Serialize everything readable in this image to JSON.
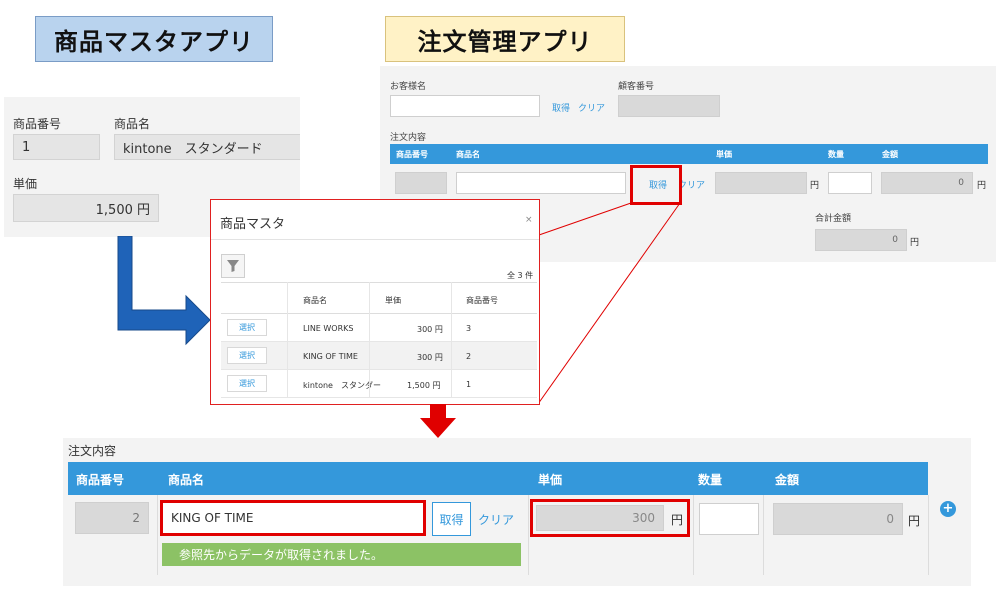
{
  "titles": {
    "product_master": "商品マスタアプリ",
    "order_app": "注文管理アプリ"
  },
  "product_master": {
    "code_label": "商品番号",
    "code_value": "1",
    "name_label": "商品名",
    "name_value": "kintone　スタンダード",
    "price_label": "単価",
    "price_value": "1,500 円"
  },
  "order_app": {
    "customer_label": "お客様名",
    "customer_value": "",
    "fetch": "取得",
    "clear": "クリア",
    "customer_no_label": "顧客番号",
    "order_content_label": "注文内容",
    "columns": [
      "商品番号",
      "商品名",
      "単価",
      "数量",
      "金額"
    ],
    "row": {
      "unit": "円",
      "amount": "0",
      "amount_unit": "円"
    },
    "total_label": "合計金額",
    "total_value": "0",
    "total_unit": "円"
  },
  "modal": {
    "title": "商品マスタ",
    "close": "×",
    "count": "全 3 件",
    "columns": [
      "商品名",
      "単価",
      "商品番号"
    ],
    "select_label": "選択",
    "rows": [
      {
        "name": "LINE WORKS",
        "price": "300 円",
        "code": "3"
      },
      {
        "name": "KING OF TIME",
        "price": "300 円",
        "code": "2"
      },
      {
        "name": "kintone　スタンダー",
        "price": "1,500 円",
        "code": "1"
      }
    ]
  },
  "result": {
    "section_label": "注文内容",
    "columns": [
      "商品番号",
      "商品名",
      "単価",
      "数量",
      "金額"
    ],
    "code": "2",
    "name": "KING OF TIME",
    "fetch": "取得",
    "clear": "クリア",
    "price": "300",
    "price_unit": "円",
    "amount": "0",
    "amount_unit": "円",
    "message": "参照先からデータが取得されました。"
  },
  "colors": {
    "accent_blue": "#3498db",
    "highlight_red": "#e00000",
    "success_green": "#8cc265",
    "arrow_blue": "#1f63b8"
  }
}
